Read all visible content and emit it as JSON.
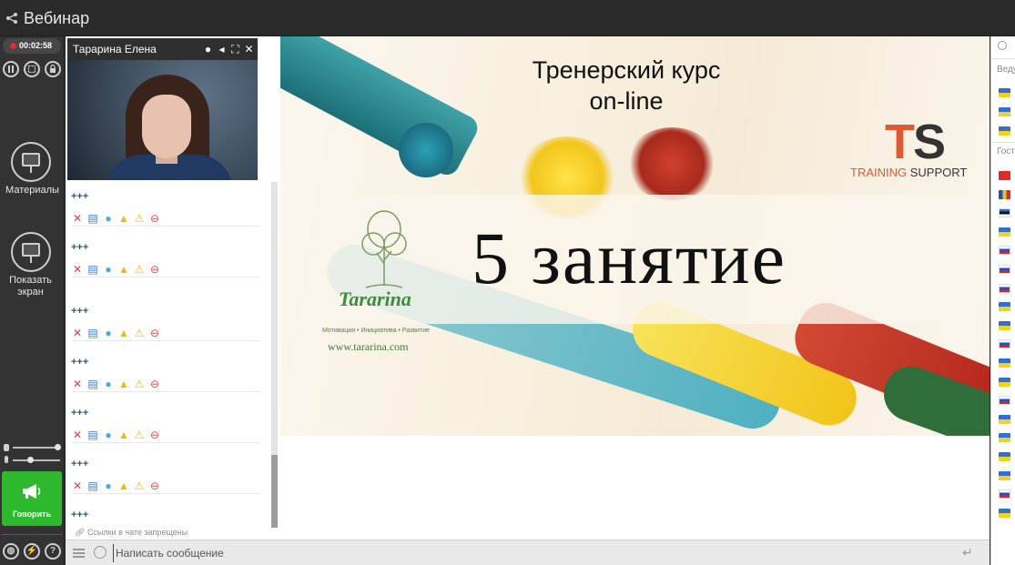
{
  "app": {
    "title": "Вебинар"
  },
  "recording": {
    "time": "00:02:58",
    "color": "#e0302b"
  },
  "left_rail": {
    "materials_label": "Материалы",
    "show_screen_label": "Показать экран",
    "speak_label": "Говорить",
    "speak_color": "#2eb82e"
  },
  "camera": {
    "presenter_name": "Тарарина Елена"
  },
  "chat": {
    "messages": [
      {
        "text": "+++"
      },
      {
        "text": "+++"
      },
      {
        "text": "+++"
      },
      {
        "text": "+++"
      },
      {
        "text": "+++"
      },
      {
        "text": "+++"
      },
      {
        "text": "+++"
      }
    ],
    "links_note": "Ссылки в чате запрещены",
    "input_placeholder": "Написать сообщение"
  },
  "slide": {
    "title_line1": "Тренерский курс",
    "title_line2": "on-line",
    "lesson": "5 занятие",
    "ts_letters_t": "T",
    "ts_letters_s": "S",
    "ts_sub_training": "TRAINING",
    "ts_sub_support": "SUPPORT",
    "tararina_name": "Tararina",
    "tararina_motto": "Мотивация • Инициатива • Развитие",
    "tararina_url": "www.tararina.com"
  },
  "participants": {
    "header_hosts": "Ведущие",
    "header_guests": "Гости",
    "host_flags": [
      "ua",
      "ua",
      "ua"
    ],
    "guest_flags": [
      "tr",
      "ro",
      "ee",
      "ua",
      "ru",
      "ru",
      "ru",
      "ua",
      "ua",
      "sk",
      "ua",
      "ua",
      "ru",
      "ua",
      "ua",
      "ua",
      "ua",
      "ru",
      "ua"
    ]
  }
}
